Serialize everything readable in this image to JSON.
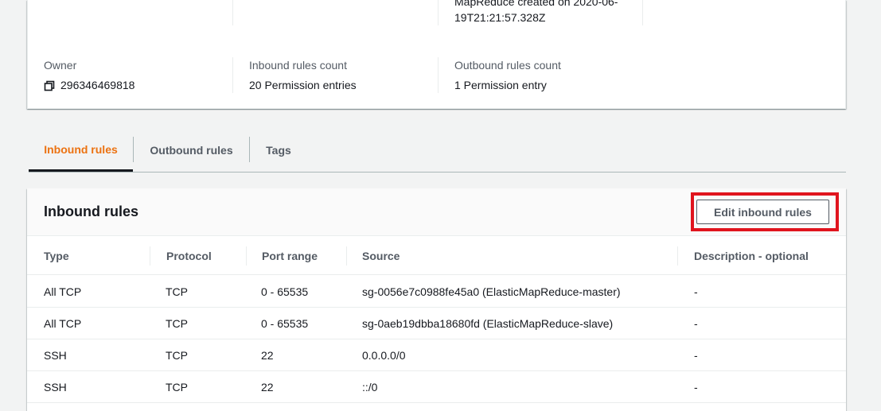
{
  "details": {
    "description_partial": "MapReduce created on 2020-06-19T21:21:57.328Z",
    "owner": {
      "label": "Owner",
      "value": "296346469818"
    },
    "inbound_count": {
      "label": "Inbound rules count",
      "value": "20 Permission entries"
    },
    "outbound_count": {
      "label": "Outbound rules count",
      "value": "1 Permission entry"
    }
  },
  "tabs": [
    {
      "label": "Inbound rules",
      "active": true
    },
    {
      "label": "Outbound rules",
      "active": false
    },
    {
      "label": "Tags",
      "active": false
    }
  ],
  "rules_panel": {
    "title": "Inbound rules",
    "edit_button_label": "Edit inbound rules",
    "highlight_color": "#e0141e"
  },
  "table": {
    "columns": [
      "Type",
      "Protocol",
      "Port range",
      "Source",
      "Description - optional"
    ],
    "rows": [
      {
        "type": "All TCP",
        "protocol": "TCP",
        "port_range": "0 - 65535",
        "source": "sg-0056e7c0988fe45a0 (ElasticMapReduce-master)",
        "description": "-"
      },
      {
        "type": "All TCP",
        "protocol": "TCP",
        "port_range": "0 - 65535",
        "source": "sg-0aeb19dbba18680fd (ElasticMapReduce-slave)",
        "description": "-"
      },
      {
        "type": "SSH",
        "protocol": "TCP",
        "port_range": "22",
        "source": "0.0.0.0/0",
        "description": "-"
      },
      {
        "type": "SSH",
        "protocol": "TCP",
        "port_range": "22",
        "source": "::/0",
        "description": "-"
      }
    ]
  },
  "colors": {
    "accent": "#ec7211",
    "text": "#16191f",
    "muted": "#545b64",
    "background": "#f2f3f3"
  },
  "icons": {
    "copy": "copy-icon"
  }
}
